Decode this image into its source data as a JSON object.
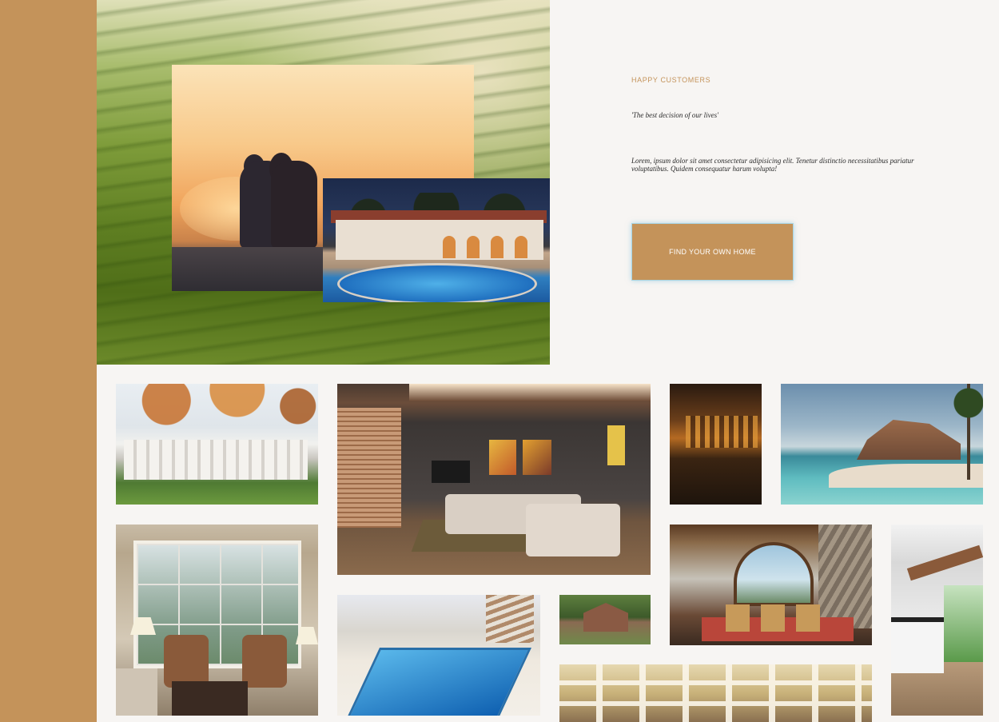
{
  "sidebar": {
    "color": "#c4935a"
  },
  "hero": {
    "background": "tea-plantation-hills",
    "photo_couple": "couple-at-sunset",
    "photo_villa": "villa-with-pool-at-night"
  },
  "testimonial": {
    "kicker": "HAPPY CUSTOMERS",
    "quote": "'The best decision of our lives'",
    "body": "Lorem, ipsum dolor sit amet consectetur adipisicing elit. Tenetur distinctio necessitatibus pariatur voluptatibus. Quidem consequatur harum volupta!",
    "cta_label": "FIND YOUR OWN HOME"
  },
  "gallery": [
    "colonial-house-autumn",
    "modern-living-room",
    "hotel-lobby-bar",
    "tropical-beach-resort",
    "sunroom-armchairs",
    "indoor-swimming-pool",
    "brick-country-house",
    "great-room-stone-fireplace",
    "white-kitchen",
    "coffered-ceiling-hall"
  ],
  "colors": {
    "accent": "#c4935a",
    "background": "#f7f5f3",
    "text": "#2a2a2a"
  }
}
